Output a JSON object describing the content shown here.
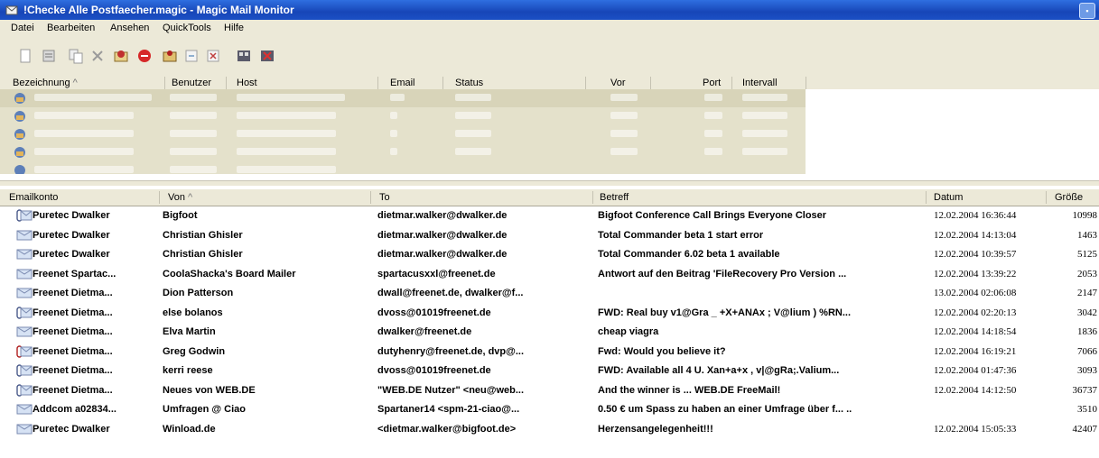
{
  "window": {
    "title": "!Checke Alle Postfaecher.magic - Magic Mail Monitor",
    "icon": "envelope-app-icon"
  },
  "menu": [
    "Datei",
    "Bearbeiten",
    "Ansehen",
    "QuickTools",
    "Hilfe"
  ],
  "toolbar_icons": [
    "new-icon",
    "properties-icon",
    "copy-icon",
    "delete-icon",
    "check-mail-icon",
    "stop-icon",
    "read-icon",
    "preview-icon",
    "delete-mail-icon",
    "settings-icon",
    "close-icon"
  ],
  "accounts_header": [
    "Bezeichnung",
    "Benutzer",
    "Host",
    "Email",
    "Status",
    "Vor",
    "Port",
    "Intervall"
  ],
  "accounts_sort_indicator": "^",
  "accounts_rows_count_visible": 5,
  "mail_header": [
    "Emailkonto",
    "Von",
    "To",
    "Betreff",
    "Datum",
    "Größe"
  ],
  "mail_sort_indicator": "^",
  "mails": [
    {
      "account": "Puretec Dwalker",
      "from": "Bigfoot",
      "to": "dietmar.walker@dwalker.de",
      "subject": "Bigfoot Conference Call Brings Everyone Closer",
      "date": "12.02.2004 16:36:44",
      "size": "10998",
      "icon": "attachment-mail-icon"
    },
    {
      "account": "Puretec Dwalker",
      "from": "Christian Ghisler",
      "to": "dietmar.walker@dwalker.de",
      "subject": "Total Commander beta 1 start error",
      "date": "12.02.2004 14:13:04",
      "size": "1463",
      "icon": "mail-icon"
    },
    {
      "account": "Puretec Dwalker",
      "from": "Christian Ghisler",
      "to": "dietmar.walker@dwalker.de",
      "subject": "Total Commander 6.02 beta 1 available",
      "date": "12.02.2004 10:39:57",
      "size": "5125",
      "icon": "mail-icon"
    },
    {
      "account": "Freenet Spartac...",
      "from": "CoolaShacka's Board Mailer",
      "to": "spartacusxxl@freenet.de",
      "subject": "Antwort auf den Beitrag 'FileRecovery Pro Version ...",
      "date": "12.02.2004 13:39:22",
      "size": "2053",
      "icon": "mail-icon"
    },
    {
      "account": "Freenet Dietma...",
      "from": "Dion Patterson",
      "to": "dwall@freenet.de, dwalker@f...",
      "subject": "",
      "date": "13.02.2004 02:06:08",
      "size": "2147",
      "icon": "mail-icon"
    },
    {
      "account": "Freenet Dietma...",
      "from": "else bolanos",
      "to": "dvoss@01019freenet.de",
      "subject": "FWD: Real buy v1@Gra _ +X+ANAx ; V@lium ) %RN...",
      "date": "12.02.2004 02:20:13",
      "size": "3042",
      "icon": "attachment-mail-icon"
    },
    {
      "account": "Freenet Dietma...",
      "from": "Elva Martin",
      "to": "dwalker@freenet.de",
      "subject": "cheap viagra",
      "date": "12.02.2004 14:18:54",
      "size": "1836",
      "icon": "mail-icon"
    },
    {
      "account": "Freenet Dietma...",
      "from": "Greg Godwin",
      "to": "dutyhenry@freenet.de, dvp@...",
      "subject": "Fwd: Would you believe it?",
      "date": "12.02.2004 16:19:21",
      "size": "7066",
      "icon": "attachment-red-mail-icon"
    },
    {
      "account": "Freenet Dietma...",
      "from": "kerri reese",
      "to": "dvoss@01019freenet.de",
      "subject": "FWD: Available all 4 U. Xan+a+x , v|@gRa;.Valium...",
      "date": "12.02.2004 01:47:36",
      "size": "3093",
      "icon": "attachment-mail-icon"
    },
    {
      "account": "Freenet Dietma...",
      "from": "Neues von WEB.DE",
      "to": "\"WEB.DE Nutzer\" <neu@web...",
      "subject": "And the winner is ... WEB.DE FreeMail!",
      "date": "12.02.2004 14:12:50",
      "size": "36737",
      "icon": "attachment-mail-icon"
    },
    {
      "account": "Addcom a02834...",
      "from": "Umfragen @ Ciao",
      "to": "Spartaner14 <spm-21-ciao@...",
      "subject": "0.50 € um Spass zu haben an einer Umfrage über f... ..",
      "date": "",
      "size": "3510",
      "icon": "mail-icon"
    },
    {
      "account": "Puretec Dwalker",
      "from": "Winload.de",
      "to": "<dietmar.walker@bigfoot.de>",
      "subject": "Herzensangelegenheit!!!",
      "date": "12.02.2004 15:05:33",
      "size": "42407",
      "icon": "mail-icon"
    }
  ]
}
